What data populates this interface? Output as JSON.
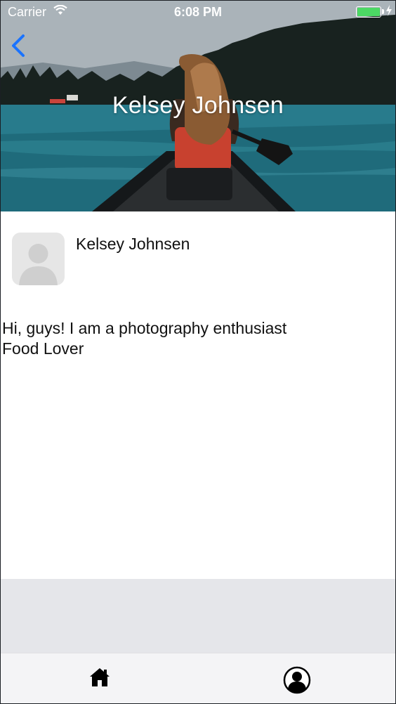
{
  "status_bar": {
    "carrier": "Carrier",
    "time": "6:08 PM",
    "battery_color": "#4cd964",
    "icons": [
      "wifi-icon",
      "battery-icon",
      "charging-icon"
    ]
  },
  "header": {
    "title": "Kelsey Johnsen",
    "back_icon": "chevron-left-icon",
    "accent_color": "#1a73ff"
  },
  "profile": {
    "name": "Kelsey Johnsen",
    "avatar_icon": "person-placeholder-icon",
    "bio_lines": [
      "Hi, guys! I am a photography enthusiast",
      "Food Lover"
    ]
  },
  "tab_bar": {
    "tabs": [
      {
        "icon": "home-icon"
      },
      {
        "icon": "user-circle-icon"
      }
    ]
  }
}
